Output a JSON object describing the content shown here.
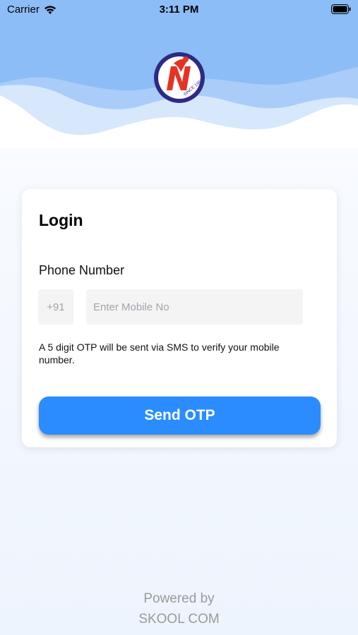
{
  "status_bar": {
    "carrier": "Carrier",
    "time": "3:11 PM",
    "icons": [
      "wifi-icon",
      "battery-icon"
    ]
  },
  "header": {
    "logo_text": "SINCE 1991",
    "logo_icon": "school-logo",
    "colors": {
      "wave_top": "#8bbcf6",
      "wave_mid": "#a9cdf8",
      "wave_light": "#d4e6fc"
    }
  },
  "login_card": {
    "title": "Login",
    "phone_label": "Phone Number",
    "country_code": "+91",
    "mobile_placeholder": "Enter Mobile No",
    "mobile_value": "",
    "otp_note": "A 5 digit OTP will be sent via SMS to verify your mobile number.",
    "send_button": "Send OTP",
    "accent": "#2a8cff"
  },
  "footer": {
    "powered_by": "Powered by",
    "brand": "SKOOL COM"
  }
}
